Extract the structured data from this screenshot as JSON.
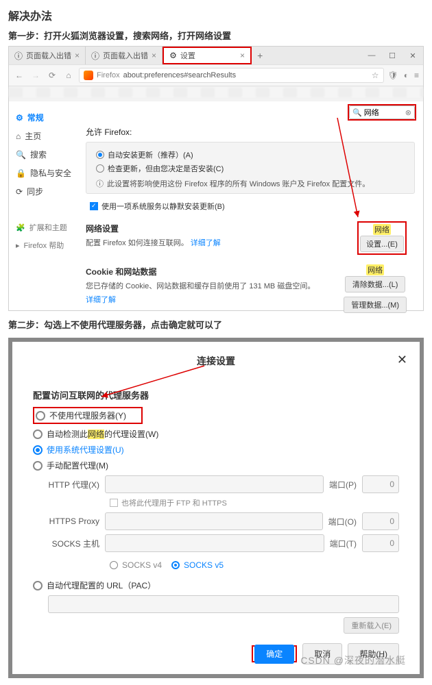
{
  "heading": "解决办法",
  "step1": "第一步：打开火狐浏览器设置，搜索网络，打开网络设置",
  "step2": "第二步：勾选上不使用代理服务器，点击确定就可以了",
  "tabs": {
    "t1": "页面载入出错",
    "t2": "页面载入出错",
    "t3": "设置",
    "plus": "+"
  },
  "win": {
    "min": "—",
    "max": "☐",
    "close": "✕"
  },
  "addr": {
    "firefox_label": "Firefox",
    "url": "about:preferences#searchResults",
    "star": "☆",
    "shield": "🛡",
    "menu": "≡"
  },
  "search": {
    "placeholder": "网络",
    "value": "网络"
  },
  "sidebar": {
    "items": [
      {
        "icon": "⚙",
        "label": "常规"
      },
      {
        "icon": "⌂",
        "label": "主页"
      },
      {
        "icon": "🔍",
        "label": "搜索"
      },
      {
        "icon": "🔒",
        "label": "隐私与安全"
      },
      {
        "icon": "⟳",
        "label": "同步"
      }
    ],
    "sub": [
      {
        "icon": "🧩",
        "label": "扩展和主题"
      },
      {
        "icon": "▸",
        "label": "Firefox 帮助"
      }
    ]
  },
  "prefs": {
    "allow_title": "允许 Firefox:",
    "r1": "自动安装更新（推荐）(A)",
    "r2": "检查更新，但由您决定是否安装(C)",
    "info": "此设置将影响使用这份 Firefox 程序的所有 Windows 账户及 Firefox 配置文件。",
    "chk1": "使用一项系统服务以静默安装更新(B)",
    "net_title": "网络设置",
    "net_desc": "配置 Firefox 如何连接互联网。",
    "learn": "详细了解",
    "hl_net": "网络",
    "net_btn": "设置...(E)",
    "cookie_title": "Cookie 和网站数据",
    "cookie_desc": "您已存储的 Cookie、网站数据和缓存目前使用了 131 MB 磁盘空间。",
    "clear_btn": "清除数据...(L)",
    "manage_btn": "管理数据...(M)"
  },
  "modal": {
    "title": "连接设置",
    "sub": "配置访问互联网的代理服务器",
    "o1": "不使用代理服务器(Y)",
    "o2_pre": "自动检测此",
    "o2_hl": "网络",
    "o2_post": "的代理设置(W)",
    "o3": "使用系统代理设置(U)",
    "o4": "手动配置代理(M)",
    "http": "HTTP 代理(X)",
    "port_p": "端口(P)",
    "port_o": "端口(O)",
    "port_t": "端口(T)",
    "ftp_chk": "也将此代理用于 FTP 和 HTTPS",
    "https": "HTTPS Proxy",
    "socks": "SOCKS 主机",
    "sv4": "SOCKS v4",
    "sv5": "SOCKS v5",
    "pac": "自动代理配置的 URL（PAC）",
    "reload": "重新载入(E)",
    "ok": "确定",
    "cancel": "取消",
    "help": "帮助(H)",
    "port_zero": "0"
  },
  "watermark": "CSDN @深夜的潜水艇"
}
